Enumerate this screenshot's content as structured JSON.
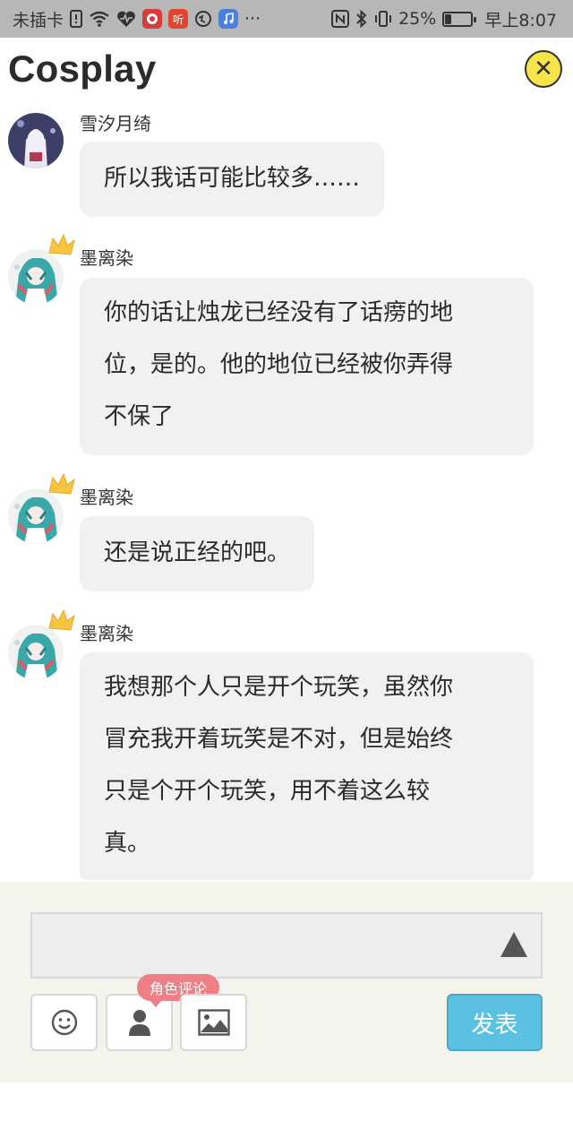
{
  "status_bar": {
    "carrier": "未插卡",
    "app_icon_2": "听",
    "more": "···",
    "battery": "25%",
    "battery_level": 0.25,
    "time": "早上8:07"
  },
  "header": {
    "title": "Cosplay",
    "close_glyph": "✕"
  },
  "messages": [
    {
      "user": "雪汐月绮",
      "crown": false,
      "lines": [
        "所以我话可能比较多……"
      ]
    },
    {
      "user": "墨离染",
      "crown": true,
      "lines": [
        "你的话让烛龙已经没有了话痨的地",
        "位，是的。他的地位已经被你弄得",
        "不保了"
      ]
    },
    {
      "user": "墨离染",
      "crown": true,
      "lines": [
        "还是说正经的吧。"
      ]
    },
    {
      "user": "墨离染",
      "crown": true,
      "lines": [
        "我想那个人只是开个玩笑，虽然你",
        "冒充我开着玩笑是不对，但是始终",
        "只是个开个玩笑，用不着这么较",
        "真。"
      ]
    }
  ],
  "composer": {
    "input_value": "",
    "role_tip": "角色评论",
    "send_label": "发表"
  },
  "colors": {
    "status_bar": "#b7b7b7",
    "bubble": "#f1f1f1",
    "composer_bg": "#f4f3ec",
    "send": "#5bc1e3",
    "role_tip": "#ee7f86",
    "close": "#f7e34a"
  },
  "icons": {
    "status_left": [
      "sim-alert-icon",
      "wifi-icon",
      "heartbeat-icon",
      "app-icon",
      "app-icon-ting",
      "browser-icon",
      "music-icon"
    ],
    "status_right": [
      "nfc-icon",
      "bluetooth-icon",
      "vibrate-icon",
      "battery-icon"
    ],
    "composer": [
      "emoji-icon",
      "person-icon",
      "image-icon",
      "expand-up-icon"
    ]
  }
}
